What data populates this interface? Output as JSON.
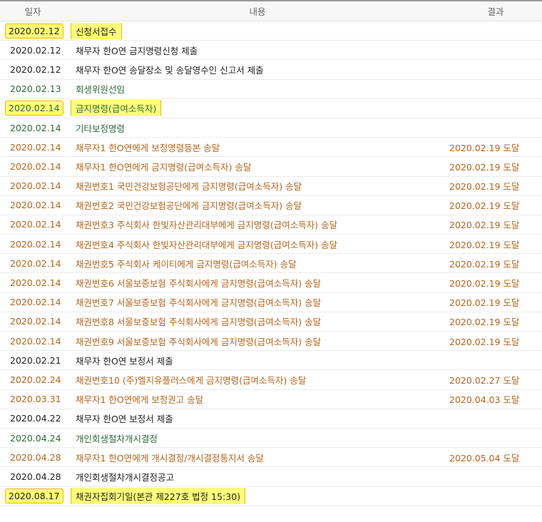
{
  "headers": {
    "date": "일자",
    "content": "내용",
    "result": "결과"
  },
  "rows": [
    {
      "date": "2020.02.12",
      "content": "신청서접수",
      "result": "",
      "color": "#222222",
      "highlight": true
    },
    {
      "date": "2020.02.12",
      "content": "채무자 한O연 금지명령신청 제출",
      "result": "",
      "color": "#222222",
      "highlight": false
    },
    {
      "date": "2020.02.12",
      "content": "채무자 한O연 송달장소 및 송달영수인 신고서 제출",
      "result": "",
      "color": "#222222",
      "highlight": false
    },
    {
      "date": "2020.02.13",
      "content": "회생위원선임",
      "result": "",
      "color": "#2e6b3c",
      "highlight": false
    },
    {
      "date": "2020.02.14",
      "content": "금지명령(급여소득자)",
      "result": "",
      "color": "#2e6b3c",
      "highlight": true
    },
    {
      "date": "2020.02.14",
      "content": "기타보정명령",
      "result": "",
      "color": "#2e6b3c",
      "highlight": false
    },
    {
      "date": "2020.02.14",
      "content": "채무자1 한O연에게 보정명령등본 송달",
      "result": "2020.02.19 도달",
      "color": "#b7651c",
      "highlight": false
    },
    {
      "date": "2020.02.14",
      "content": "채무자1 한O연에게 금지명령(급여소득자) 송달",
      "result": "2020.02.19 도달",
      "color": "#b7651c",
      "highlight": false
    },
    {
      "date": "2020.02.14",
      "content": "채권번호1 국민건강보험공단에게 금지명령(급여소득자) 송달",
      "result": "2020.02.19 도달",
      "color": "#b7651c",
      "highlight": false
    },
    {
      "date": "2020.02.14",
      "content": "채권번호2 국민건강보험공단에게 금지명령(급여소득자) 송달",
      "result": "2020.02.19 도달",
      "color": "#b7651c",
      "highlight": false
    },
    {
      "date": "2020.02.14",
      "content": "채권번호3 주식회사 한빛자산관리대부에게 금지명령(급여소득자) 송달",
      "result": "2020.02.19 도달",
      "color": "#b7651c",
      "highlight": false
    },
    {
      "date": "2020.02.14",
      "content": "채권번호4 주식회사 한빛자산관리대부에게 금지명령(급여소득자) 송달",
      "result": "2020.02.19 도달",
      "color": "#b7651c",
      "highlight": false
    },
    {
      "date": "2020.02.14",
      "content": "채권번호5 주식회사 케이티에게 금지명령(급여소득자) 송달",
      "result": "2020.02.19 도달",
      "color": "#b7651c",
      "highlight": false
    },
    {
      "date": "2020.02.14",
      "content": "채권번호6 서울보증보험 주식회사에게 금지명령(급여소득자) 송달",
      "result": "2020.02.19 도달",
      "color": "#b7651c",
      "highlight": false
    },
    {
      "date": "2020.02.14",
      "content": "채권번호7 서울보증보험 주식회사에게 금지명령(급여소득자) 송달",
      "result": "2020.02.19 도달",
      "color": "#b7651c",
      "highlight": false
    },
    {
      "date": "2020.02.14",
      "content": "채권번호8 서울보증보험 주식회사에게 금지명령(급여소득자) 송달",
      "result": "2020.02.19 도달",
      "color": "#b7651c",
      "highlight": false
    },
    {
      "date": "2020.02.14",
      "content": "채권번호9 서울보증보험 주식회사에게 금지명령(급여소득자) 송달",
      "result": "2020.02.19 도달",
      "color": "#b7651c",
      "highlight": false
    },
    {
      "date": "2020.02.21",
      "content": "채무자 한O연 보정서 제출",
      "result": "",
      "color": "#222222",
      "highlight": false
    },
    {
      "date": "2020.02.24",
      "content": "채권번호10 (주)엘지유플러스에게 금지명령(급여소득자) 송달",
      "result": "2020.02.27 도달",
      "color": "#b7651c",
      "highlight": false
    },
    {
      "date": "2020.03.31",
      "content": "채무자1 한O연에게 보정권고 송달",
      "result": "2020.04.03 도달",
      "color": "#b7651c",
      "highlight": false
    },
    {
      "date": "2020.04.22",
      "content": "채무자 한O연 보정서 제출",
      "result": "",
      "color": "#222222",
      "highlight": false
    },
    {
      "date": "2020.04.24",
      "content": "개인회생절차개시결정",
      "result": "",
      "color": "#2e6b3c",
      "highlight": false
    },
    {
      "date": "2020.04.28",
      "content": "채무자1 한O연에게 개시결정/개시결정통지서 송달",
      "result": "2020.05.04 도달",
      "color": "#b7651c",
      "highlight": false
    },
    {
      "date": "2020.04.28",
      "content": "개인회생절차개시결정공고",
      "result": "",
      "color": "#222222",
      "highlight": false
    },
    {
      "date": "2020.08.17",
      "content": "채권자집회기일(본관 제227호 법정 15:30)",
      "result": "",
      "color": "#222222",
      "highlight": true
    }
  ]
}
